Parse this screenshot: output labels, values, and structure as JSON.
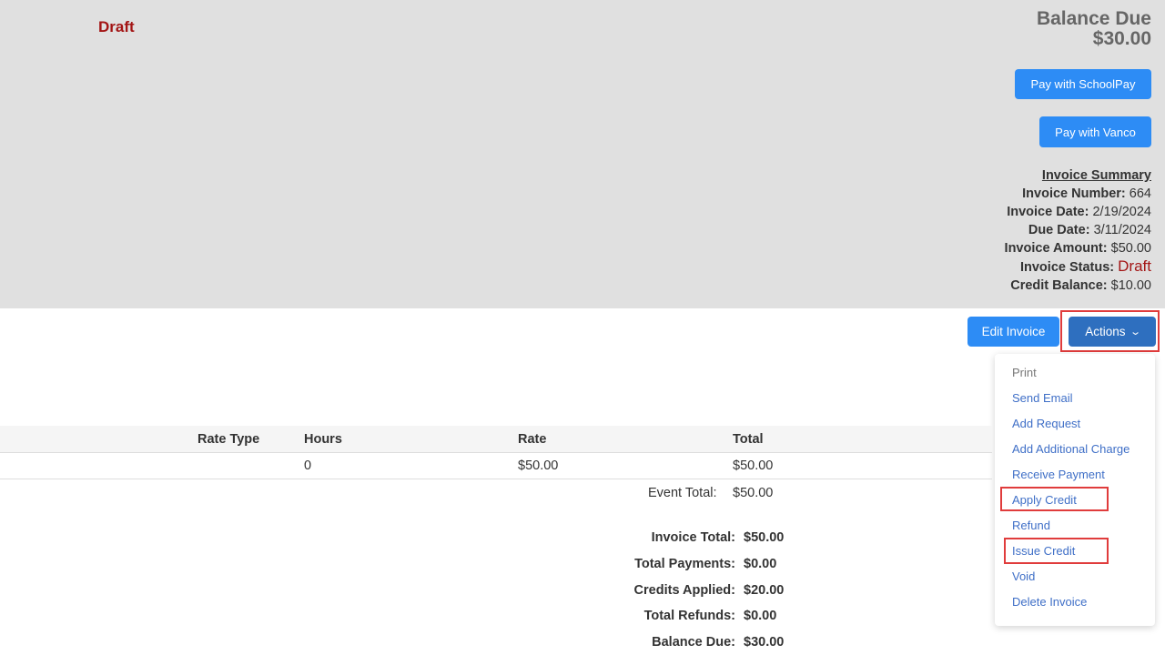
{
  "header": {
    "draft_label": "Draft",
    "balance_title": "Balance Due",
    "balance_amount": "$30.00",
    "pay_schoolpay": "Pay with SchoolPay",
    "pay_vanco": "Pay with Vanco"
  },
  "summary": {
    "title": "Invoice Summary",
    "invoice_number_label": "Invoice Number:",
    "invoice_number": "664",
    "invoice_date_label": "Invoice Date:",
    "invoice_date": "2/19/2024",
    "due_date_label": "Due Date:",
    "due_date": "3/11/2024",
    "invoice_amount_label": "Invoice Amount:",
    "invoice_amount": "$50.00",
    "invoice_status_label": "Invoice Status:",
    "invoice_status": "Draft",
    "credit_balance_label": "Credit Balance:",
    "credit_balance": "$10.00"
  },
  "toolbar": {
    "edit_invoice": "Edit Invoice",
    "actions": "Actions"
  },
  "actions_menu": [
    "Print",
    "Send Email",
    "Add Request",
    "Add Additional Charge",
    "Receive Payment",
    "Apply Credit",
    "Refund",
    "Issue Credit",
    "Void",
    "Delete Invoice"
  ],
  "table": {
    "headers": [
      "Rate Type",
      "Hours",
      "Rate",
      "Total"
    ],
    "row": [
      "",
      "0",
      "$50.00",
      "$50.00"
    ],
    "event_total_label": "Event Total:",
    "event_total": "$50.00"
  },
  "totals": {
    "invoice_total_label": "Invoice Total:",
    "invoice_total": "$50.00",
    "total_payments_label": "Total Payments:",
    "total_payments": "$0.00",
    "credits_applied_label": "Credits Applied:",
    "credits_applied": "$20.00",
    "total_refunds_label": "Total Refunds:",
    "total_refunds": "$0.00",
    "balance_due_label": "Balance Due:",
    "balance_due": "$30.00"
  },
  "colors": {
    "primary_button": "#2d8cf5",
    "actions_button": "#2e6fbf",
    "draft_red": "#a31515",
    "highlight_red": "#e03c3c",
    "menu_link": "#3f6fc7",
    "header_bg": "#e0e0e0"
  },
  "icons": {
    "actions_chevron": "chevron-down-icon"
  }
}
